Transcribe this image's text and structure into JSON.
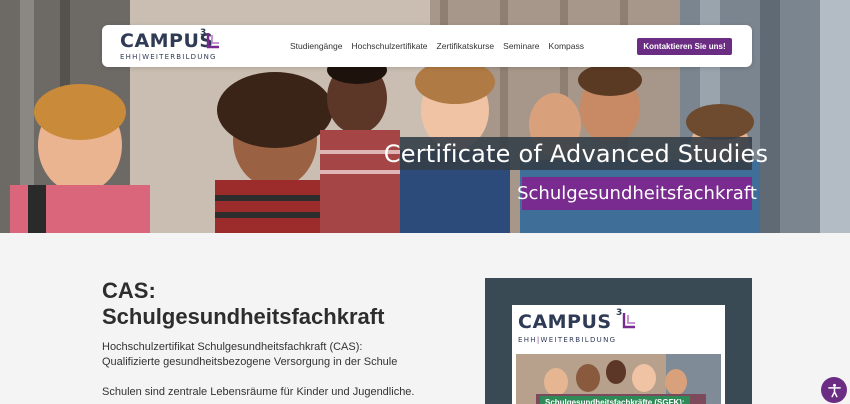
{
  "brand": {
    "logo_main": "CAMPUS",
    "logo_superscript": "3",
    "logo_prefix": "EHH",
    "logo_suffix": "WEITERBILDUNG",
    "color_primary": "#6b2d83",
    "color_dark": "#2f3a55"
  },
  "nav": {
    "items": [
      {
        "label": "Studiengänge"
      },
      {
        "label": "Hochschulzertifikate"
      },
      {
        "label": "Zertifikatskurse"
      },
      {
        "label": "Seminare"
      },
      {
        "label": "Kompass"
      }
    ],
    "cta_label": "Kontaktieren Sie uns!"
  },
  "hero": {
    "title": "Certificate of Advanced Studies",
    "subtitle": "Schulgesundheitsfachkraft"
  },
  "main": {
    "heading": "CAS: Schulgesundheitsfachkraft",
    "lead_line1": "Hochschulzertifikat Schulgesundheitsfachkraft (CAS):",
    "lead_line2": "Qualifizierte gesundheitsbezogene Versorgung in der Schule",
    "paragraph": "Schulen sind zentrale Lebensräume für Kinder und Jugendliche."
  },
  "media_card": {
    "banner": "Schulgesundheitsfachkräfte (SGFK):"
  },
  "accessibility": {
    "icon": "accessibility-icon"
  }
}
